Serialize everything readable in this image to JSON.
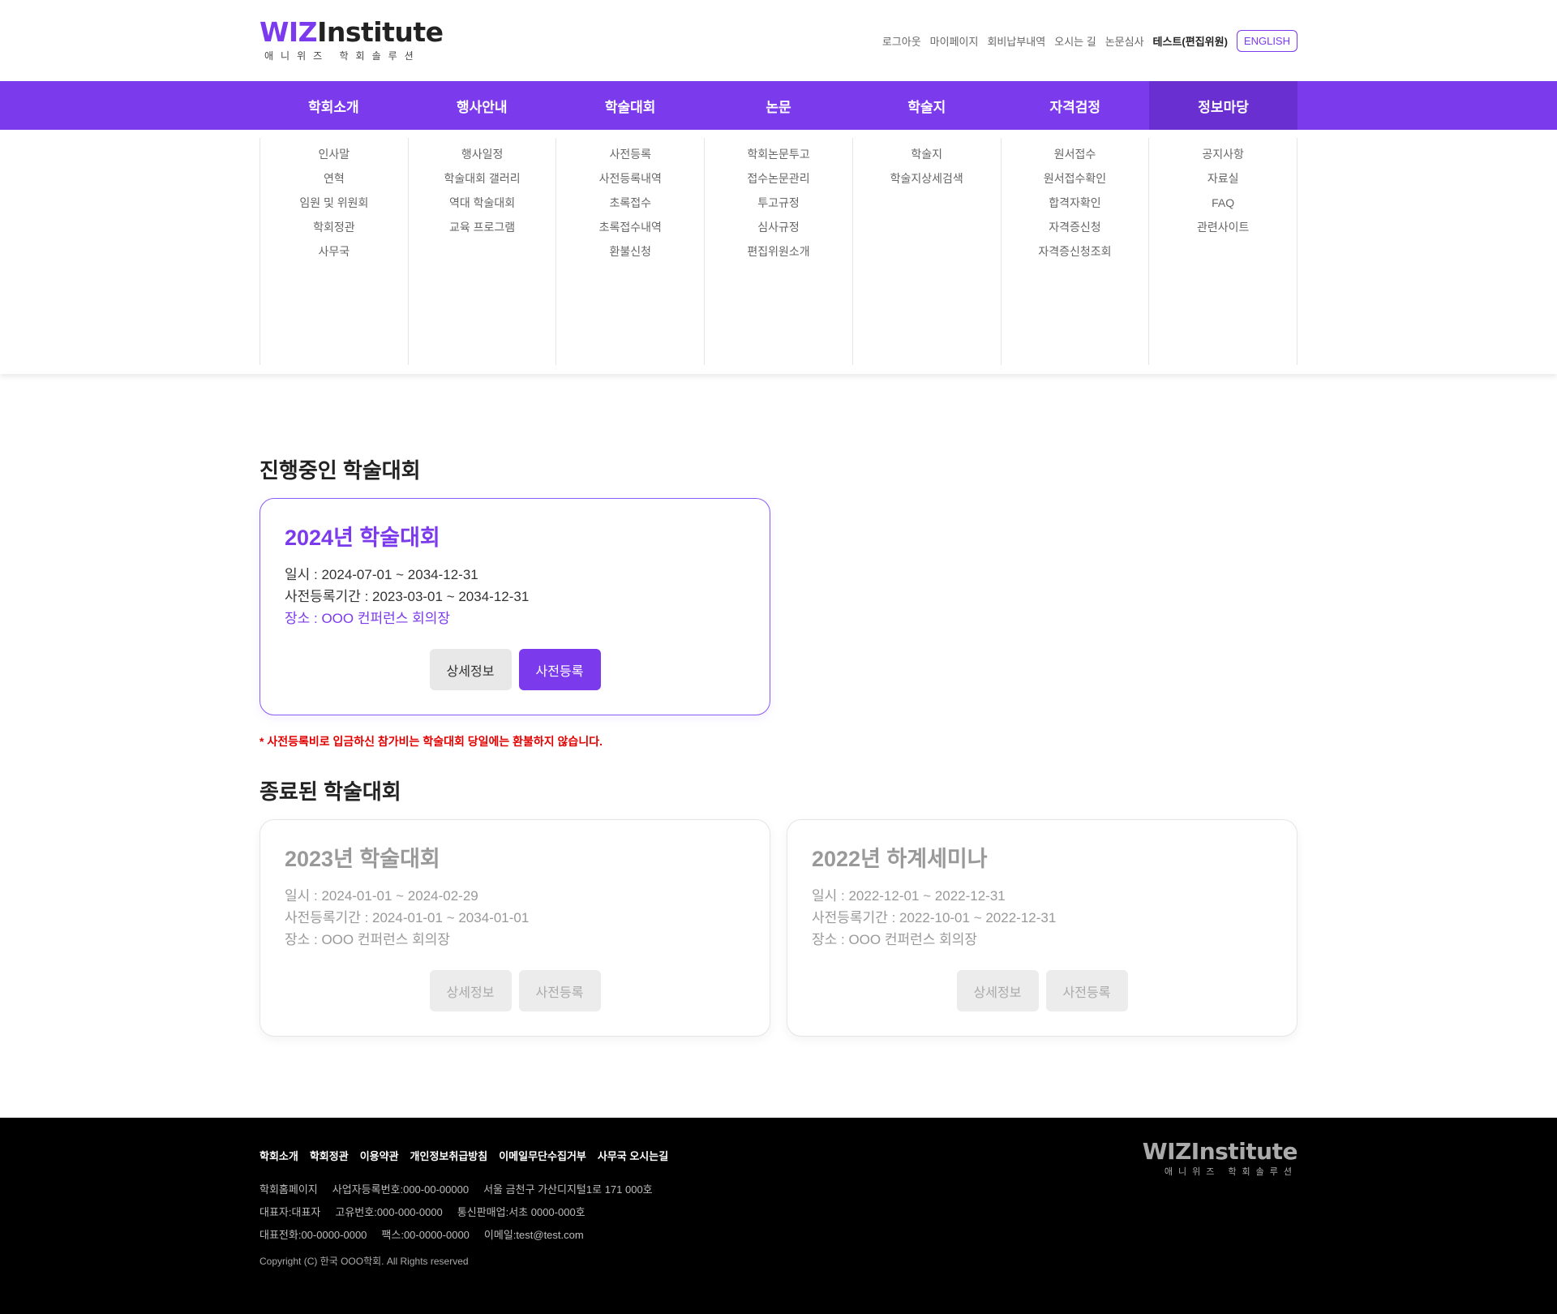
{
  "logo": {
    "brand_wiz": "WIZ",
    "brand_institute": "Institute",
    "tagline": "애니위즈 학회솔루션"
  },
  "util_nav": {
    "items": [
      "로그아웃",
      "마이페이지",
      "회비납부내역",
      "오시는 길",
      "논문심사"
    ],
    "user": "테스트(편집위원)",
    "english": "ENGLISH"
  },
  "gnb": [
    "학회소개",
    "행사안내",
    "학술대회",
    "논문",
    "학술지",
    "자격검정",
    "정보마당"
  ],
  "mega_menu": [
    [
      "인사말",
      "연혁",
      "임원 및 위원회",
      "학회정관",
      "사무국"
    ],
    [
      "행사일정",
      "학술대회 갤러리",
      "역대 학술대회",
      "교육 프로그램"
    ],
    [
      "사전등록",
      "사전등록내역",
      "초록접수",
      "초록접수내역",
      "환불신청"
    ],
    [
      "학회논문투고",
      "접수논문관리",
      "투고규정",
      "심사규정",
      "편집위원소개"
    ],
    [
      "학술지",
      "학술지상세검색"
    ],
    [
      "원서접수",
      "원서접수확인",
      "합격자확인",
      "자격증신청",
      "자격증신청조회"
    ],
    [
      "공지사항",
      "자료실",
      "FAQ",
      "관련사이트"
    ]
  ],
  "ongoing": {
    "title": "진행중인 학술대회",
    "card": {
      "name": "2024년 학술대회",
      "date": "일시 : 2024-07-01 ~ 2034-12-31",
      "reg": "사전등록기간 : 2023-03-01 ~ 2034-12-31",
      "place": "장소 : OOO 컨퍼런스 회의장",
      "btn_detail": "상세정보",
      "btn_register": "사전등록"
    },
    "notice": "* 사전등록비로 입금하신 참가비는 학술대회 당일에는 환불하지 않습니다."
  },
  "ended": {
    "title": "종료된 학술대회",
    "cards": [
      {
        "name": "2023년 학술대회",
        "date": "일시 : 2024-01-01 ~ 2024-02-29",
        "reg": "사전등록기간 : 2024-01-01 ~ 2034-01-01",
        "place": "장소 : OOO 컨퍼런스 회의장",
        "btn_detail": "상세정보",
        "btn_register": "사전등록"
      },
      {
        "name": "2022년 하계세미나",
        "date": "일시 : 2022-12-01 ~ 2022-12-31",
        "reg": "사전등록기간 : 2022-10-01 ~ 2022-12-31",
        "place": "장소 : OOO 컨퍼런스 회의장",
        "btn_detail": "상세정보",
        "btn_register": "사전등록"
      }
    ]
  },
  "footer": {
    "links": [
      "학회소개",
      "학회정관",
      "이용약관",
      "개인정보취급방침",
      "이메일무단수집거부",
      "사무국 오시는길"
    ],
    "info_rows": [
      [
        "학회홈페이지",
        "사업자등록번호:000-00-00000",
        "서울 금천구 가산디지털1로 171 000호"
      ],
      [
        "대표자:대표자",
        "고유번호:000-000-0000",
        "통신판매업:서초 0000-000호"
      ],
      [
        "대표전화:00-0000-0000",
        "팩스:00-0000-0000",
        "이메일:test@test.com"
      ]
    ],
    "copyright": "Copyright (C) 한국 OOO학회. All Rights reserved",
    "logo_main": "WIZInstitute",
    "logo_sub": "애니위즈 학회솔루션"
  },
  "colors": {
    "accent": "#7c3aed",
    "accent_dark": "#6a2fd0",
    "notice": "#e30000",
    "footer_bg": "#000000"
  }
}
